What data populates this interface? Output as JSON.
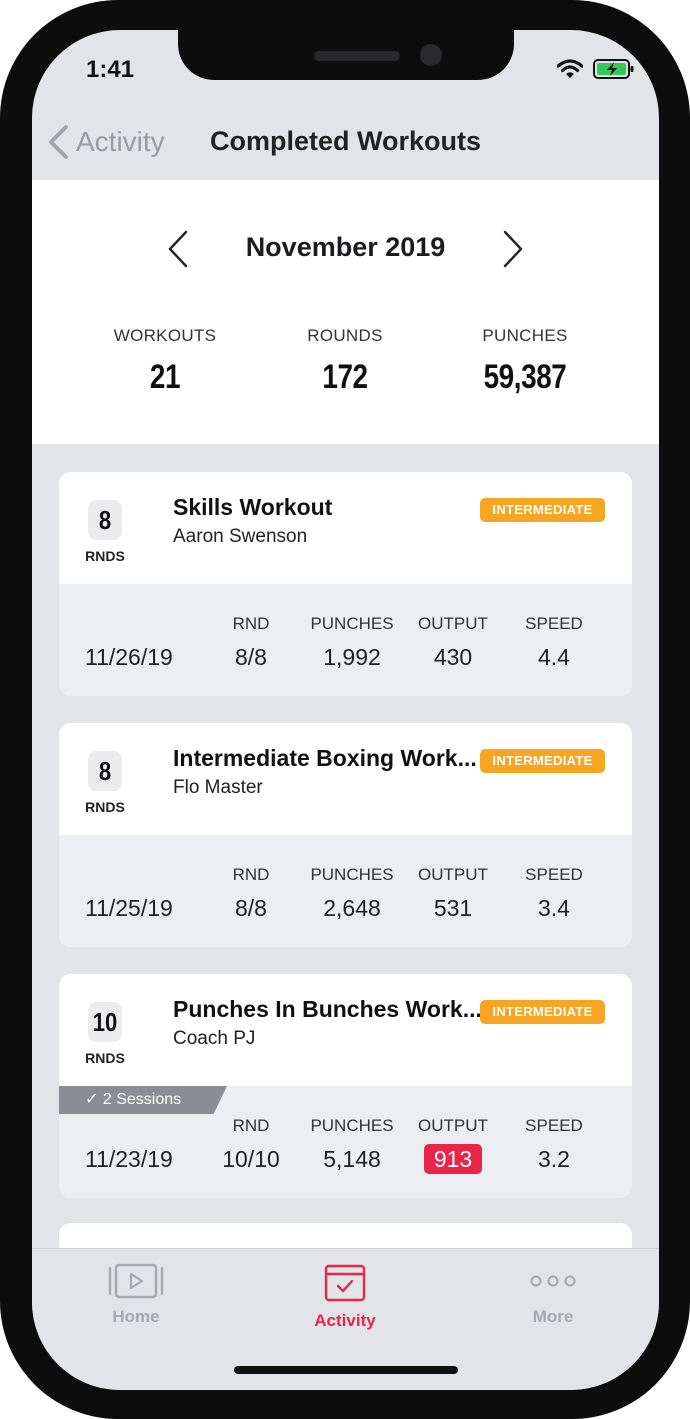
{
  "status": {
    "time": "1:41"
  },
  "nav": {
    "back_label": "Activity",
    "title": "Completed Workouts"
  },
  "summary": {
    "month": "November 2019",
    "stats": [
      {
        "label": "WORKOUTS",
        "value": "21"
      },
      {
        "label": "ROUNDS",
        "value": "172"
      },
      {
        "label": "PUNCHES",
        "value": "59,387"
      }
    ]
  },
  "metric_labels": {
    "rnd": "RND",
    "punches": "PUNCHES",
    "output": "OUTPUT",
    "speed": "SPEED"
  },
  "workouts": [
    {
      "rounds": "8",
      "rounds_unit": "RNDS",
      "title": "Skills Workout",
      "coach": "Aaron Swenson",
      "level": "INTERMEDIATE",
      "date": "11/26/19",
      "rnd": "8/8",
      "punches": "1,992",
      "output": "430",
      "speed": "4.4"
    },
    {
      "rounds": "8",
      "rounds_unit": "RNDS",
      "title": "Intermediate Boxing Work...",
      "coach": "Flo Master",
      "level": "INTERMEDIATE",
      "date": "11/25/19",
      "rnd": "8/8",
      "punches": "2,648",
      "output": "531",
      "speed": "3.4"
    },
    {
      "rounds": "10",
      "rounds_unit": "RNDS",
      "title": "Punches In Bunches Work...",
      "coach": "Coach PJ",
      "level": "INTERMEDIATE",
      "sessions": "✓ 2 Sessions",
      "date": "11/23/19",
      "rnd": "10/10",
      "punches": "5,148",
      "output": "913",
      "speed": "3.2",
      "output_highlight_color": "#e8254a"
    }
  ],
  "colors": {
    "accent": "#e8254a",
    "level_badge": "#f6a623",
    "inactive_tab": "#a7a8ad"
  },
  "tabs": [
    {
      "label": "Home",
      "icon": "video-play-icon",
      "active": false
    },
    {
      "label": "Activity",
      "icon": "calendar-check-icon",
      "active": true
    },
    {
      "label": "More",
      "icon": "ellipsis-icon",
      "active": false
    }
  ]
}
